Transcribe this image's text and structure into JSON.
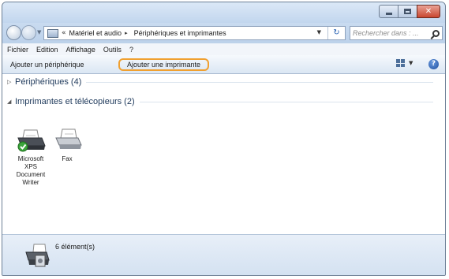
{
  "window": {
    "caption_buttons": {
      "minimize": "minimize-icon",
      "maximize": "maximize-icon",
      "close": "close-icon"
    }
  },
  "address": {
    "prefix": "«",
    "breadcrumb": [
      "Matériel et audio",
      "Périphériques et imprimantes"
    ],
    "separator": "▸",
    "refresh": "↻",
    "search_placeholder": "Rechercher dans : ..."
  },
  "menu": [
    "Fichier",
    "Edition",
    "Affichage",
    "Outils",
    "?"
  ],
  "toolbar": {
    "add_device": "Ajouter un périphérique",
    "add_printer": "Ajouter une imprimante",
    "help": "?"
  },
  "groups": {
    "devices": {
      "title": "Périphériques (4)",
      "expanded": false
    },
    "printers": {
      "title": "Imprimantes et télécopieurs (2)",
      "expanded": true
    }
  },
  "printers": [
    {
      "name": "Microsoft XPS Document Writer",
      "label_lines": [
        "Microsoft",
        "XPS",
        "Document",
        "Writer"
      ],
      "default": true,
      "icon": "printer-icon"
    },
    {
      "name": "Fax",
      "label_lines": [
        "Fax"
      ],
      "default": false,
      "icon": "fax-icon"
    }
  ],
  "details": {
    "count_text": "6 élément(s)",
    "icon": "printer-devices-icon"
  },
  "colors": {
    "highlight": "#f0a030",
    "accent": "#1e395b",
    "window_frame": "#cfe0f2"
  }
}
